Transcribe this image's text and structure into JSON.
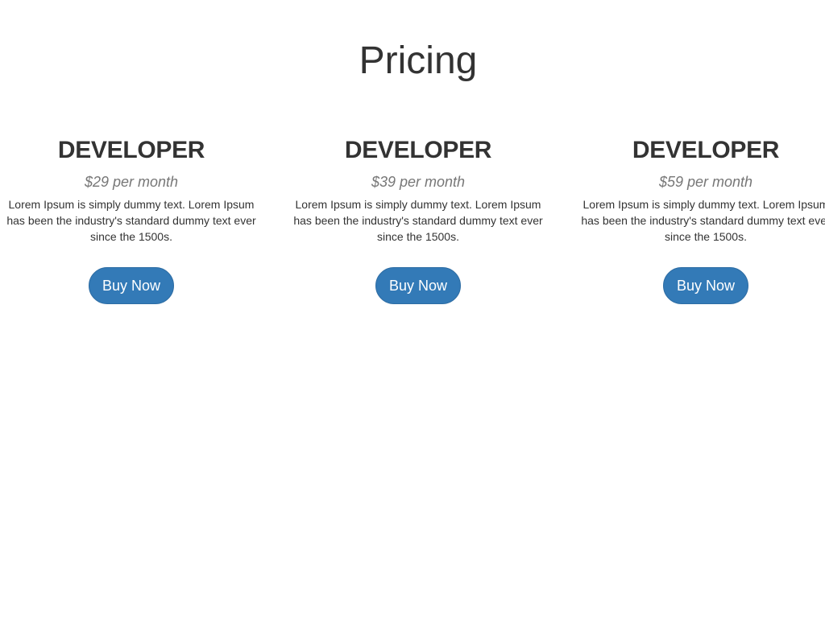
{
  "page": {
    "title": "Pricing"
  },
  "plans": [
    {
      "name": "DEVELOPER",
      "price": "$29 per month",
      "description": "Lorem Ipsum is simply dummy text. Lorem Ipsum has been the industry's standard dummy text ever since the 1500s.",
      "button_label": "Buy Now"
    },
    {
      "name": "DEVELOPER",
      "price": "$39 per month",
      "description": "Lorem Ipsum is simply dummy text. Lorem Ipsum has been the industry's standard dummy text ever since the 1500s.",
      "button_label": "Buy Now"
    },
    {
      "name": "DEVELOPER",
      "price": "$59 per month",
      "description": "Lorem Ipsum is simply dummy text. Lorem Ipsum has been the industry's standard dummy text ever since the 1500s.",
      "button_label": "Buy Now"
    }
  ],
  "colors": {
    "text": "#333333",
    "muted": "#777777",
    "button_bg": "#337ab7",
    "button_text": "#ffffff"
  }
}
